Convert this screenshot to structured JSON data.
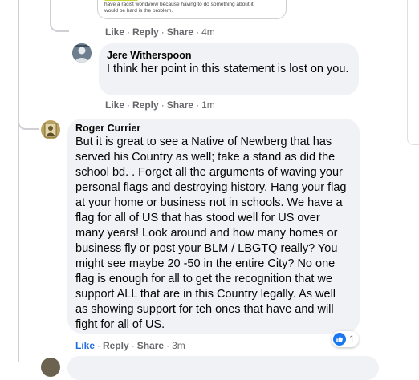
{
  "embed": {
    "text_line1": "have a racist worldview because having to do something about it",
    "text_line2": "would be hard is the problem."
  },
  "comments": [
    {
      "actions": {
        "like": "Like",
        "reply": "Reply",
        "share": "Share",
        "time": "4m"
      }
    },
    {
      "author": "Jere Witherspoon",
      "text": "I think her point in this statement is lost on you.",
      "actions": {
        "like": "Like",
        "reply": "Reply",
        "share": "Share",
        "time": "1m"
      }
    },
    {
      "author": "Roger Currier",
      "text": "But it is great to see a Native of Newberg that has served his Country as well; take a stand as did the school bd. . Forget all the arguments of waving your personal flags and destroying history. Hang your flag at your home or business not in schools. We have a flag for all of US that has stood well for US over many years! Look around and how many homes or business fly or post your BLM / LBGTQ really? You might see maybe 20 -50 in the entire City? No one flag is enough for all to get the recognition that we support ALL that are in this Country legally. As well as showing support for teh ones that have and will fight for all of US.",
      "actions": {
        "like": "Like",
        "reply": "Reply",
        "share": "Share",
        "time": "3m"
      },
      "reaction": {
        "icon": "thumbs-up-icon",
        "count": "1"
      }
    }
  ],
  "colors": {
    "bubble": "#f0f2f5",
    "action_text": "#65676b",
    "liked": "#216fdb",
    "like_icon": "#1877f2",
    "thread_line": "#ced0d4"
  }
}
